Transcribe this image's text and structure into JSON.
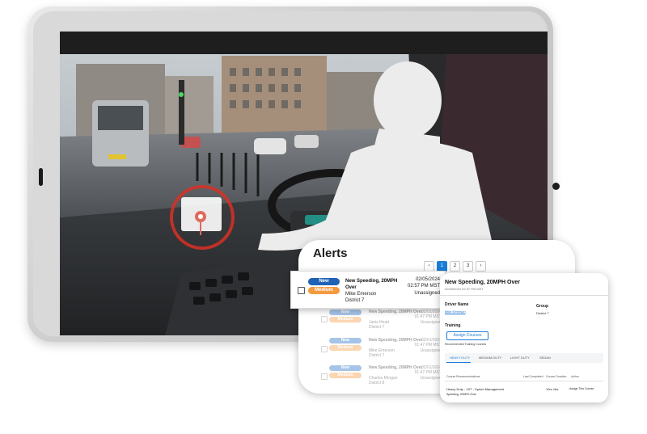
{
  "alerts": {
    "title": "Alerts",
    "pagination": {
      "prev": "‹",
      "pages": [
        "1",
        "2",
        "3"
      ],
      "next": "›",
      "active": "1"
    },
    "rows": [
      {
        "badge_status": "New",
        "badge_severity": "Medium",
        "title": "New Speeding, 20MPH Over",
        "driver": "Mike Emerson",
        "district": "District 7",
        "date": "02/05/2024",
        "time": "02:57 PM MST",
        "assignment": "Unassigned"
      },
      {
        "badge_status": "New",
        "badge_severity": "Medium",
        "title": "New Speeding, 20MPH Over",
        "driver": "Janis Head",
        "district": "District 7",
        "date": "02/01/2024",
        "time": "01:47 PM MST",
        "assignment": "Unassigned"
      },
      {
        "badge_status": "New",
        "badge_severity": "Medium",
        "title": "New Speeding, 20MPH Over",
        "driver": "Mike Emerson",
        "district": "District 7",
        "date": "02/01/2024",
        "time": "01:47 PM MST",
        "assignment": "Unassigned"
      },
      {
        "badge_status": "New",
        "badge_severity": "Medium",
        "title": "New Speeding, 20MPH Over",
        "driver": "Charles Morgan",
        "district": "District 8",
        "date": "02/01/2024",
        "time": "01:47 PM MST",
        "assignment": "Unassigned"
      }
    ]
  },
  "detail": {
    "title": "New Speeding, 20MPH Over",
    "date": "02/05/2024 02:57 PM MST",
    "driver_label": "Driver Name",
    "driver_value": "Mike Emerson",
    "group_label": "Group",
    "group_value": "District 7",
    "training_label": "Training",
    "assign_button": "Assign Courses",
    "recommended_label": "Recommended Training Courses",
    "tabs": [
      "HEAVY DUTY",
      "MEDIUM DUTY",
      "LIGHT DUTY",
      "SEDAN"
    ],
    "table_headers": [
      "Course Recommendations",
      "Last Completed",
      "Course Duration",
      "Action"
    ],
    "course": {
      "name": "Heavy Duty - 1ST - Speed Management",
      "sub": "Speeding, 20MPH Over",
      "duration": "10m 16s",
      "action": "Assign This Course"
    }
  },
  "colors": {
    "accent": "#1b7cd6",
    "badge_new": "#1e63b5",
    "badge_medium": "#f39a3f",
    "alert_ring": "#d93025"
  },
  "icons": {
    "alert_marker": "map-pin-icon"
  }
}
